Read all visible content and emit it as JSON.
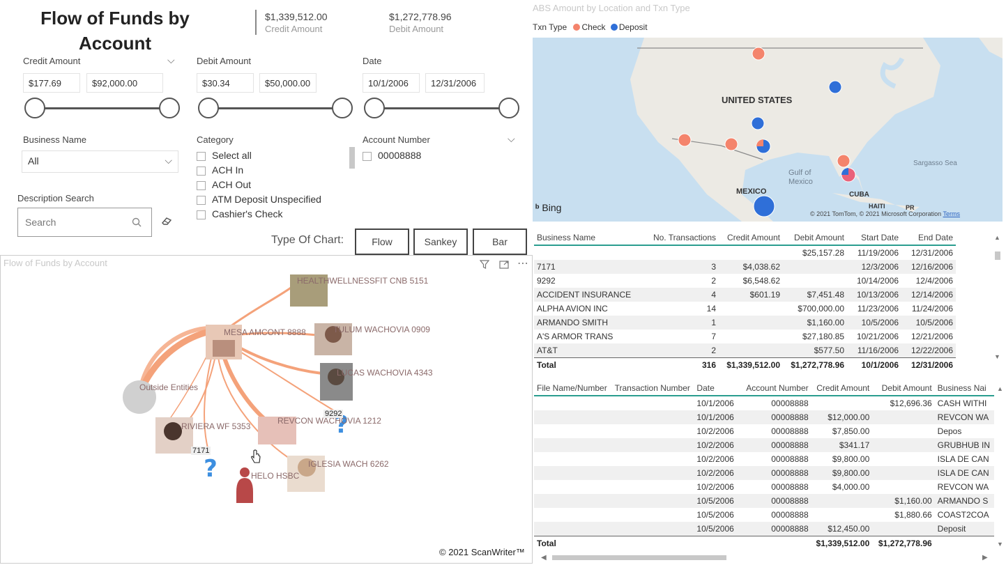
{
  "header": {
    "title": "Flow of Funds by Account"
  },
  "kpis": [
    {
      "value": "$1,339,512.00",
      "label": "Credit Amount"
    },
    {
      "value": "$1,272,778.96",
      "label": "Debit Amount"
    }
  ],
  "filters": {
    "credit": {
      "label": "Credit Amount",
      "min": "$177.69",
      "max": "$92,000.00"
    },
    "debit": {
      "label": "Debit Amount",
      "min": "$30.34",
      "max": "$50,000.00"
    },
    "date": {
      "label": "Date",
      "min": "10/1/2006",
      "max": "12/31/2006"
    },
    "business": {
      "label": "Business Name",
      "value": "All"
    },
    "category": {
      "label": "Category",
      "items": [
        "Select all",
        "ACH In",
        "ACH Out",
        "ATM Deposit Unspecified",
        "Cashier's Check"
      ]
    },
    "account": {
      "label": "Account Number",
      "items": [
        "00008888"
      ]
    },
    "description": {
      "label": "Description Search",
      "placeholder": "Search"
    }
  },
  "chart_type": {
    "label": "Type Of Chart:",
    "buttons": [
      "Flow",
      "Sankey",
      "Bar"
    ]
  },
  "flow": {
    "title": "Flow of Funds by Account",
    "nodes": [
      "HEALTHWELLNESSFIT CNB 5151",
      "MESA AMCONT 8888",
      "TULUM WACHOVIA 0909",
      "LUCAS WACHOVIA 4343",
      "Outside Entities",
      "RIVIERA WF 5353",
      "REVCON WACHOVIA 1212",
      "IGLESIA WACH 6262",
      "HELO HSBC"
    ],
    "tags": [
      "9292",
      "7171"
    ],
    "copyright": "© 2021 ScanWriter™"
  },
  "map": {
    "title": "ABS Amount by Location and Txn Type",
    "legend_title": "Txn Type",
    "legend": [
      {
        "name": "Check",
        "color": "#f4846c"
      },
      {
        "name": "Deposit",
        "color": "#2f6fd8"
      }
    ],
    "labels": [
      "UNITED STATES",
      "MEXICO",
      "Gulf of Mexico",
      "CUBA",
      "HAITI",
      "PR",
      "Sargasso Sea"
    ],
    "bing": "Bing",
    "attribution": "© 2021 TomTom, © 2021 Microsoft Corporation",
    "terms": "Terms"
  },
  "summary_table": {
    "columns": [
      "Business Name",
      "No. Transactions",
      "Credit Amount",
      "Debit Amount",
      "Start Date",
      "End Date"
    ],
    "rows": [
      [
        "",
        "",
        "",
        "$25,157.28",
        "11/19/2006",
        "12/31/2006"
      ],
      [
        "7171",
        "3",
        "$4,038.62",
        "",
        "12/3/2006",
        "12/16/2006"
      ],
      [
        "9292",
        "2",
        "$6,548.62",
        "",
        "10/14/2006",
        "12/4/2006"
      ],
      [
        "ACCIDENT INSURANCE",
        "4",
        "$601.19",
        "$7,451.48",
        "10/13/2006",
        "12/14/2006"
      ],
      [
        "ALPHA AVION INC",
        "14",
        "",
        "$700,000.00",
        "11/23/2006",
        "11/24/2006"
      ],
      [
        "ARMANDO SMITH",
        "1",
        "",
        "$1,160.00",
        "10/5/2006",
        "10/5/2006"
      ],
      [
        "A'S ARMOR TRANS",
        "7",
        "",
        "$27,180.85",
        "10/21/2006",
        "12/21/2006"
      ],
      [
        "AT&T",
        "2",
        "",
        "$577.50",
        "11/16/2006",
        "12/22/2006"
      ]
    ],
    "total": [
      "Total",
      "316",
      "$1,339,512.00",
      "$1,272,778.96",
      "10/1/2006",
      "12/31/2006"
    ]
  },
  "detail_table": {
    "columns": [
      "File Name/Number",
      "Transaction Number",
      "Date",
      "Account Number",
      "Credit Amount",
      "Debit Amount",
      "Business Nai"
    ],
    "rows": [
      [
        "",
        "",
        "10/1/2006",
        "00008888",
        "",
        "$12,696.36",
        "CASH WITHI"
      ],
      [
        "",
        "",
        "10/1/2006",
        "00008888",
        "$12,000.00",
        "",
        "REVCON WA"
      ],
      [
        "",
        "",
        "10/2/2006",
        "00008888",
        "$7,850.00",
        "",
        "Depos"
      ],
      [
        "",
        "",
        "10/2/2006",
        "00008888",
        "$341.17",
        "",
        "GRUBHUB IN"
      ],
      [
        "",
        "",
        "10/2/2006",
        "00008888",
        "$9,800.00",
        "",
        "ISLA DE CAN"
      ],
      [
        "",
        "",
        "10/2/2006",
        "00008888",
        "$9,800.00",
        "",
        "ISLA DE CAN"
      ],
      [
        "",
        "",
        "10/2/2006",
        "00008888",
        "$4,000.00",
        "",
        "REVCON WA"
      ],
      [
        "",
        "",
        "10/5/2006",
        "00008888",
        "",
        "$1,160.00",
        "ARMANDO S"
      ],
      [
        "",
        "",
        "10/5/2006",
        "00008888",
        "",
        "$1,880.66",
        "COAST2COA"
      ],
      [
        "",
        "",
        "10/5/2006",
        "00008888",
        "$12,450.00",
        "",
        "Deposit"
      ]
    ],
    "total": [
      "Total",
      "",
      "",
      "",
      "$1,339,512.00",
      "$1,272,778.96",
      ""
    ]
  }
}
